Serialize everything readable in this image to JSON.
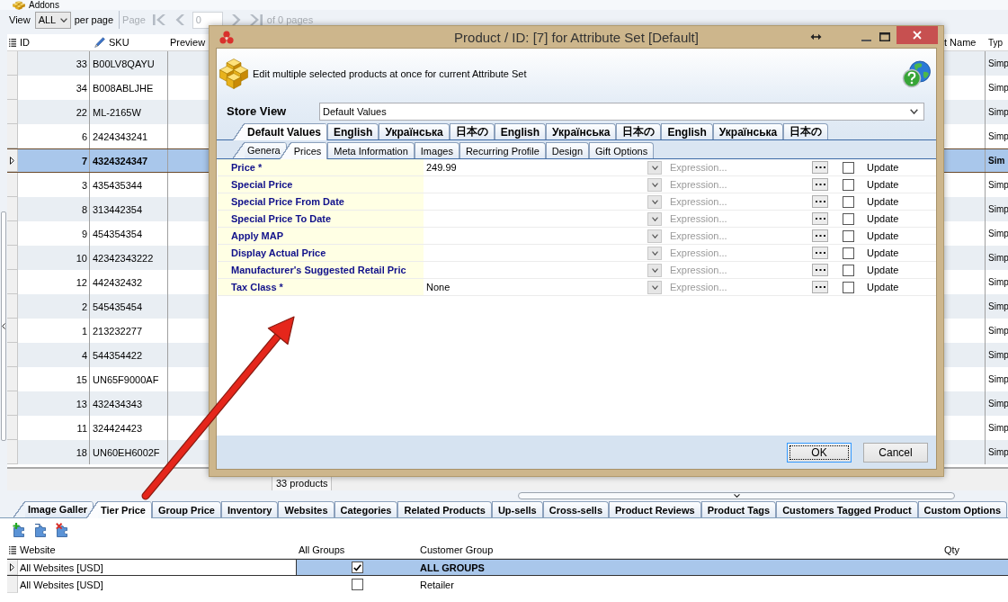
{
  "app": {
    "title": "Addons"
  },
  "toolbar": {
    "view_label": "View",
    "view_value": "ALL",
    "per_page_label": "per page",
    "pager": {
      "label": "Page",
      "disabled": true,
      "value": "0",
      "summary": "of 0 pages"
    }
  },
  "grid": {
    "columns": [
      {
        "kind": "id",
        "label": "ID"
      },
      {
        "kind": "sku",
        "label": "SKU"
      },
      {
        "kind": "preview",
        "label": "Preview"
      },
      {
        "kind": "name",
        "label": "t Name"
      },
      {
        "kind": "type",
        "label": "Typ"
      }
    ],
    "rows": [
      {
        "id": "33",
        "sku": "B00LV8QAYU",
        "type": "Simp",
        "selected": false
      },
      {
        "id": "34",
        "sku": "B008ABLJHE",
        "type": "Simp",
        "selected": false
      },
      {
        "id": "22",
        "sku": "ML-2165W",
        "type": "Simp",
        "selected": false
      },
      {
        "id": "6",
        "sku": "2424343241",
        "type": "Simp",
        "selected": false
      },
      {
        "id": "7",
        "sku": "4324324347",
        "type": "Sim",
        "selected": true
      },
      {
        "id": "3",
        "sku": "435435344",
        "type": "Simp",
        "selected": false
      },
      {
        "id": "8",
        "sku": "313442354",
        "type": "Simp",
        "selected": false
      },
      {
        "id": "9",
        "sku": "454354354",
        "type": "Simp",
        "selected": false
      },
      {
        "id": "10",
        "sku": "42342343222",
        "type": "Simp",
        "selected": false
      },
      {
        "id": "12",
        "sku": "442432432",
        "type": "Simp",
        "selected": false
      },
      {
        "id": "2",
        "sku": "545435454",
        "type": "Simp",
        "selected": false
      },
      {
        "id": "1",
        "sku": "213232277",
        "type": "Simp",
        "selected": false
      },
      {
        "id": "4",
        "sku": "544354422",
        "type": "Simp",
        "selected": false
      },
      {
        "id": "15",
        "sku": "UN65F9000AF",
        "type": "Simp",
        "selected": false
      },
      {
        "id": "13",
        "sku": "432434343",
        "type": "Simp",
        "selected": false
      },
      {
        "id": "11",
        "sku": "324424423",
        "type": "Simp",
        "selected": false
      },
      {
        "id": "18",
        "sku": "UN60EH6002F",
        "type": "Simp",
        "selected": false
      }
    ],
    "footer": "33 products"
  },
  "detail_tabs": [
    {
      "label": "Image Galler",
      "selected": false
    },
    {
      "label": "Tier Price",
      "selected": true
    },
    {
      "label": "Group Price",
      "selected": false
    },
    {
      "label": "Inventory",
      "selected": false
    },
    {
      "label": "Websites",
      "selected": false
    },
    {
      "label": "Categories",
      "selected": false
    },
    {
      "label": "Related Products",
      "selected": false
    },
    {
      "label": "Up-sells",
      "selected": false
    },
    {
      "label": "Cross-sells",
      "selected": false
    },
    {
      "label": "Product Reviews",
      "selected": false
    },
    {
      "label": "Product Tags",
      "selected": false
    },
    {
      "label": "Customers Tagged Product",
      "selected": false
    },
    {
      "label": "Custom Options",
      "selected": false
    }
  ],
  "tier_price": {
    "columns": [
      {
        "kind": "website",
        "label": "Website"
      },
      {
        "kind": "all_groups",
        "label": "All Groups"
      },
      {
        "kind": "customer_group",
        "label": "Customer Group"
      },
      {
        "kind": "qty",
        "label": "Qty"
      }
    ],
    "rows": [
      {
        "website": "All Websites [USD]",
        "all_groups": true,
        "customer_group": "ALL GROUPS",
        "selected": true
      },
      {
        "website": "All Websites [USD]",
        "all_groups": false,
        "customer_group": "Retailer",
        "selected": false
      }
    ]
  },
  "dialog": {
    "title": "Product / ID: [7] for Attribute Set [Default]",
    "description": "Edit multiple selected products at once for current Attribute Set",
    "store_view": {
      "label": "Store View",
      "value": "Default Values"
    },
    "store_tabs": [
      {
        "label": "Default Values",
        "selected": true
      },
      {
        "label": "English",
        "selected": false
      },
      {
        "label": "Українська",
        "selected": false
      },
      {
        "label": "日本の",
        "selected": false
      },
      {
        "label": "English",
        "selected": false
      },
      {
        "label": "Українська",
        "selected": false
      },
      {
        "label": "日本の",
        "selected": false
      },
      {
        "label": "English",
        "selected": false
      },
      {
        "label": "Українська",
        "selected": false
      },
      {
        "label": "日本の",
        "selected": false
      }
    ],
    "section_tabs": [
      {
        "label": "Genera",
        "selected": false
      },
      {
        "label": "Prices",
        "selected": true
      },
      {
        "label": "Meta Information",
        "selected": false
      },
      {
        "label": "Images",
        "selected": false
      },
      {
        "label": "Recurring Profile",
        "selected": false
      },
      {
        "label": "Design",
        "selected": false
      },
      {
        "label": "Gift Options",
        "selected": false
      }
    ],
    "attributes": [
      {
        "label": "Price *",
        "value": "249.99",
        "placeholder": "Expression...",
        "update": false,
        "update_label": "Update"
      },
      {
        "label": "Special Price",
        "placeholder": "Expression...",
        "update": false,
        "update_label": "Update"
      },
      {
        "label": "Special Price From Date",
        "placeholder": "Expression...",
        "update": false,
        "update_label": "Update"
      },
      {
        "label": "Special Price To Date",
        "placeholder": "Expression...",
        "update": false,
        "update_label": "Update"
      },
      {
        "label": "Apply MAP",
        "placeholder": "Expression...",
        "update": false,
        "update_label": "Update"
      },
      {
        "label": "Display Actual Price",
        "placeholder": "Expression...",
        "update": false,
        "update_label": "Update"
      },
      {
        "label": "Manufacturer's Suggested Retail Pric",
        "placeholder": "Expression...",
        "update": false,
        "update_label": "Update"
      },
      {
        "label": "Tax Class *",
        "value": "None",
        "placeholder": "Expression...",
        "update": false,
        "update_label": "Update"
      }
    ],
    "buttons": [
      {
        "label": "OK",
        "focused": true
      },
      {
        "label": "Cancel",
        "focused": false
      }
    ]
  }
}
